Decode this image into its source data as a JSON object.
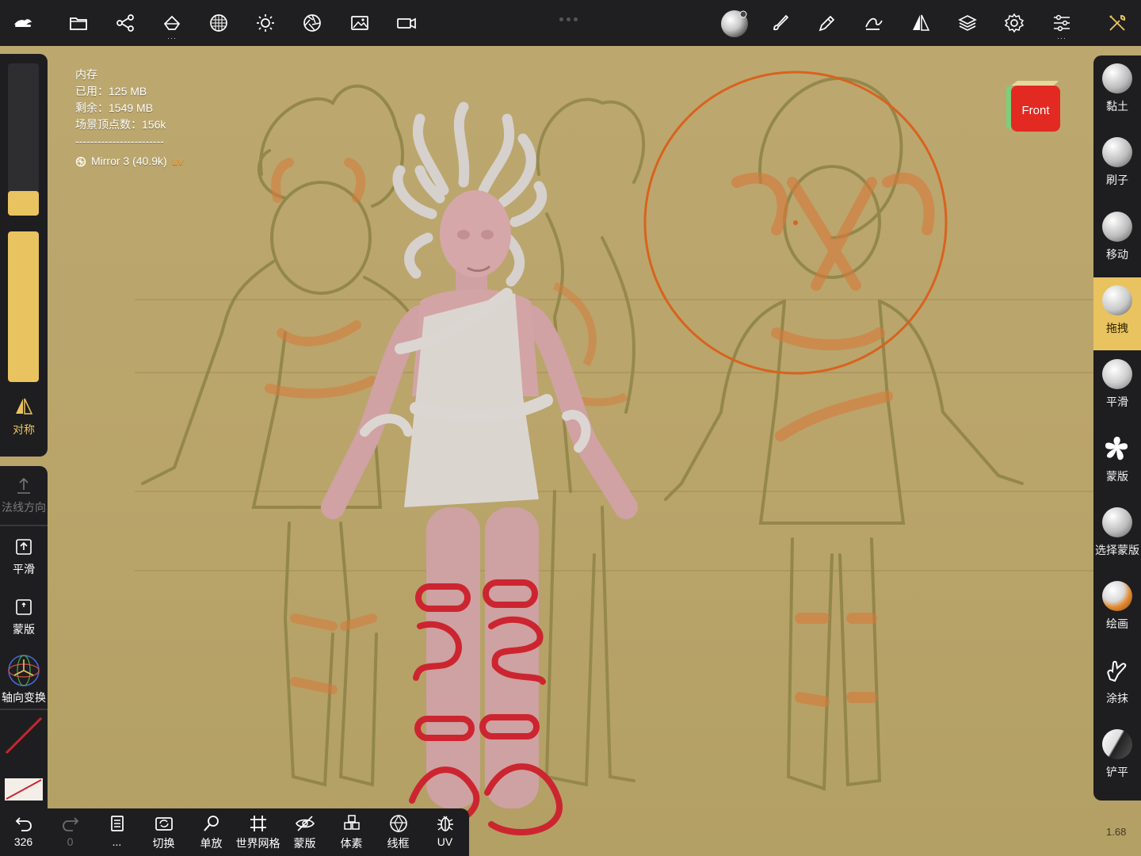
{
  "colors": {
    "accent": "#e9c35f",
    "panel": "#1e1e20",
    "brush_circle": "#d9621f",
    "sketch_line": "#8d8246",
    "sketch_orange": "#d77a3a",
    "model_skin": "#d3a4a5",
    "model_white": "#d9d4cf",
    "mask_red": "#cc2530"
  },
  "topbar": {
    "left_icons": [
      "app-logo-icon",
      "folder-icon",
      "share-icon",
      "scene-icon",
      "material-icon",
      "light-icon",
      "shading-icon",
      "background-image-icon",
      "camera-icon"
    ],
    "right_icons": [
      "material-sphere-icon",
      "brush-icon",
      "pen-icon",
      "stroke-icon",
      "symmetry-icon",
      "layers-icon",
      "settings-icon",
      "sliders-icon",
      "tools-icon"
    ]
  },
  "left_panel": {
    "radius_value": 0.16,
    "intensity_value": 1.0,
    "symmetry_label": "对称",
    "normal_dir_label": "法线方向",
    "smooth_label": "平滑",
    "mask_label": "蒙版",
    "gizmo_label": "轴向变换"
  },
  "stats": {
    "title": "内存",
    "used": "已用：125 MB",
    "free": "剩余：1549 MB",
    "vertices": "场景顶点数：156k",
    "divider": "------------------------",
    "mesh_name": "Mirror 3 (40.9k)",
    "mesh_tag": "uv"
  },
  "view_cube": {
    "face": "Front"
  },
  "right_panel": {
    "tools": [
      {
        "label": "黏土",
        "icon": "clay-icon"
      },
      {
        "label": "刷子",
        "icon": "brush-sphere-icon"
      },
      {
        "label": "移动",
        "icon": "move-icon"
      },
      {
        "label": "拖拽",
        "icon": "drag-icon",
        "active": true
      },
      {
        "label": "平滑",
        "icon": "smooth-icon"
      },
      {
        "label": "蒙版",
        "icon": "mask-icon"
      },
      {
        "label": "选择蒙版",
        "icon": "select-mask-icon"
      },
      {
        "label": "绘画",
        "icon": "paint-icon"
      },
      {
        "label": "涂抹",
        "icon": "smudge-icon"
      },
      {
        "label": "铲平",
        "icon": "flatten-icon"
      }
    ]
  },
  "bottombar": {
    "undo_count": "326",
    "redo_count": "0",
    "more_label": "...",
    "items": [
      {
        "label": "切换",
        "icon": "switch-camera-icon"
      },
      {
        "label": "单放",
        "icon": "isolate-icon"
      },
      {
        "label": "世界网格",
        "icon": "world-grid-icon"
      },
      {
        "label": "蒙版",
        "icon": "hide-mask-icon"
      },
      {
        "label": "体素",
        "icon": "voxel-icon"
      },
      {
        "label": "线框",
        "icon": "wireframe-icon"
      },
      {
        "label": "UV",
        "icon": "uv-icon"
      }
    ]
  },
  "version": "1.68"
}
